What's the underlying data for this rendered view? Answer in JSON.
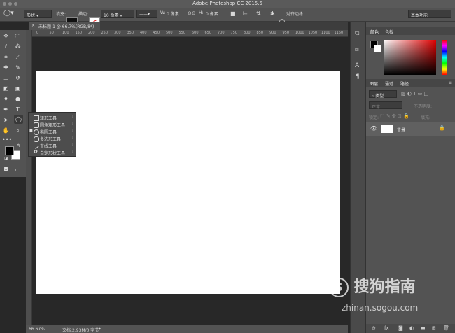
{
  "window": {
    "title": "Adobe Photoshop CC 2015.5"
  },
  "options_bar": {
    "mode": "形状",
    "fill_label": "填充:",
    "stroke_label": "描边:",
    "stroke_width": "10 像素",
    "w_label": "W:",
    "w_value": "0 像素",
    "h_label": "H:",
    "h_value": "0 像素",
    "align_edges": "对齐边缘",
    "workspace": "基本功能"
  },
  "document": {
    "tab_label": "未标题-1 @ 66.7%(RGB/8*)"
  },
  "ruler": {
    "h_ticks": [
      "0",
      "50",
      "100",
      "150",
      "200",
      "250",
      "300",
      "350",
      "400",
      "450",
      "500",
      "550",
      "600",
      "650",
      "700",
      "750",
      "800",
      "850",
      "900",
      "950",
      "1000",
      "1050",
      "1100",
      "1150"
    ]
  },
  "flyout": {
    "items": [
      {
        "label": "矩形工具",
        "shortcut": "U",
        "icon": "rectangle-icon",
        "selected": false
      },
      {
        "label": "圆角矩形工具",
        "shortcut": "U",
        "icon": "rounded-rectangle-icon",
        "selected": false
      },
      {
        "label": "椭圆工具",
        "shortcut": "U",
        "icon": "ellipse-icon",
        "selected": true
      },
      {
        "label": "多边形工具",
        "shortcut": "U",
        "icon": "polygon-icon",
        "selected": false
      },
      {
        "label": "直线工具",
        "shortcut": "U",
        "icon": "line-icon",
        "selected": false
      },
      {
        "label": "自定形状工具",
        "shortcut": "U",
        "icon": "custom-shape-icon",
        "selected": false
      }
    ]
  },
  "status": {
    "zoom": "66.67%",
    "doc_info": "文档:2.93M/0 字节"
  },
  "panels": {
    "color_tab": "颜色",
    "swatches_tab": "色板",
    "layers_tab": "图层",
    "channels_tab": "通道",
    "paths_tab": "路径",
    "kind_label": "类型",
    "blend_mode": "正常",
    "opacity_label": "不透明度:",
    "lock_label": "锁定:",
    "fill_label": "填充:",
    "layer_name": "背景"
  },
  "watermark": {
    "brand": "搜狗指南",
    "url": "zhinan.sogou.com"
  },
  "colors": {
    "ui_dark": "#282828",
    "panel": "#535353",
    "canvas": "#ffffff"
  }
}
